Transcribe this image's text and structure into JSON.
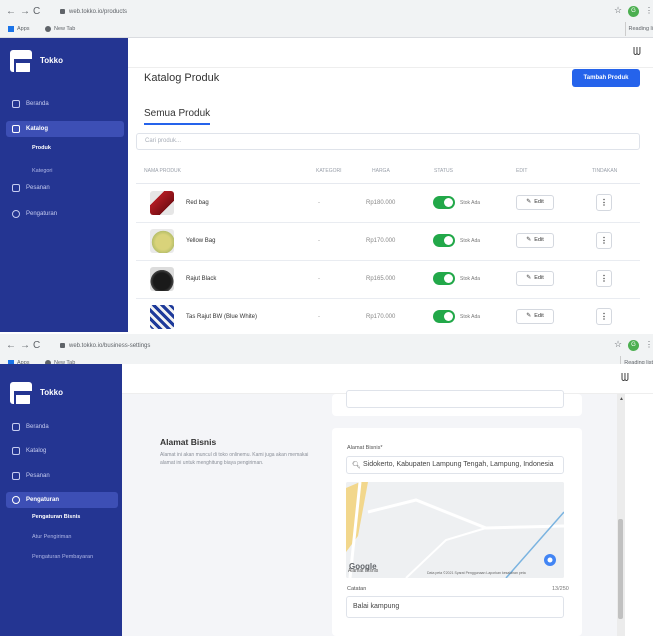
{
  "screen1": {
    "browser": {
      "url": "web.tokko.io/products",
      "bookmarks": [
        "Apps",
        "New Tab"
      ],
      "reading_list": "Reading li",
      "profile_initial": "G"
    },
    "sidebar": {
      "brand": "Tokko",
      "items": [
        {
          "label": "Beranda",
          "active": false
        },
        {
          "label": "Katalog",
          "active": true
        },
        {
          "label": "Pesanan",
          "active": false
        },
        {
          "label": "Pengaturan",
          "active": false
        }
      ],
      "subitems": [
        {
          "label": "Produk",
          "active": true
        },
        {
          "label": "Kategori",
          "active": false
        }
      ]
    },
    "header": {
      "page_title": "Katalog Produk",
      "add_button": "Tambah Produk",
      "section_title": "Semua Produk",
      "search_placeholder": "Cari produk..."
    },
    "table": {
      "columns": [
        "NAMA PRODUK",
        "KATEGORI",
        "HARGA",
        "STATUS",
        "EDIT",
        "TINDAKAN"
      ],
      "rows": [
        {
          "name": "Red bag",
          "category": "-",
          "price": "Rp180.000",
          "status": "Stok Ada",
          "edit": "Edit",
          "more": "⋮"
        },
        {
          "name": "Yellow Bag",
          "category": "-",
          "price": "Rp170.000",
          "status": "Stok Ada",
          "edit": "Edit",
          "more": "⋮"
        },
        {
          "name": "Rajut Black",
          "category": "-",
          "price": "Rp165.000",
          "status": "Stok Ada",
          "edit": "Edit",
          "more": "⋮"
        },
        {
          "name": "Tas Rajut BW (Blue White)",
          "category": "-",
          "price": "Rp170.000",
          "status": "Stok Ada",
          "edit": "Edit",
          "more": "⋮"
        }
      ]
    }
  },
  "screen2": {
    "browser": {
      "url": "web.tokko.io/business-settings",
      "bookmarks": [
        "Apps",
        "New Tab"
      ],
      "reading_list": "Reading list",
      "profile_initial": "G"
    },
    "sidebar": {
      "brand": "Tokko",
      "items": [
        {
          "label": "Beranda",
          "active": false
        },
        {
          "label": "Katalog",
          "active": false
        },
        {
          "label": "Pesanan",
          "active": false
        },
        {
          "label": "Pengaturan",
          "active": true
        }
      ],
      "subitems": [
        {
          "label": "Pengaturan Bisnis",
          "active": true
        },
        {
          "label": "Atur Pengiriman",
          "active": false
        },
        {
          "label": "Pengaturan Pembayaran",
          "active": false
        }
      ]
    },
    "address": {
      "heading": "Alamat Bisnis",
      "description": "Alamat ini akan muncul di toko onlinemu. Kami juga akan memakai alamat ini untuk menghitung biaya pengiriman.",
      "field_label": "Alamat Bisnis*",
      "field_value": "Sidokerto, Kabupaten Lampung Tengah, Lampung, Indonesia",
      "map_logo": "Google",
      "map_footer": "Data peta ©2021   Syarat Penggunaan   Laporkan kesalahan peta",
      "notes_label": "Catatan",
      "notes_count": "13/250",
      "notes_value": "Balai kampung"
    }
  }
}
